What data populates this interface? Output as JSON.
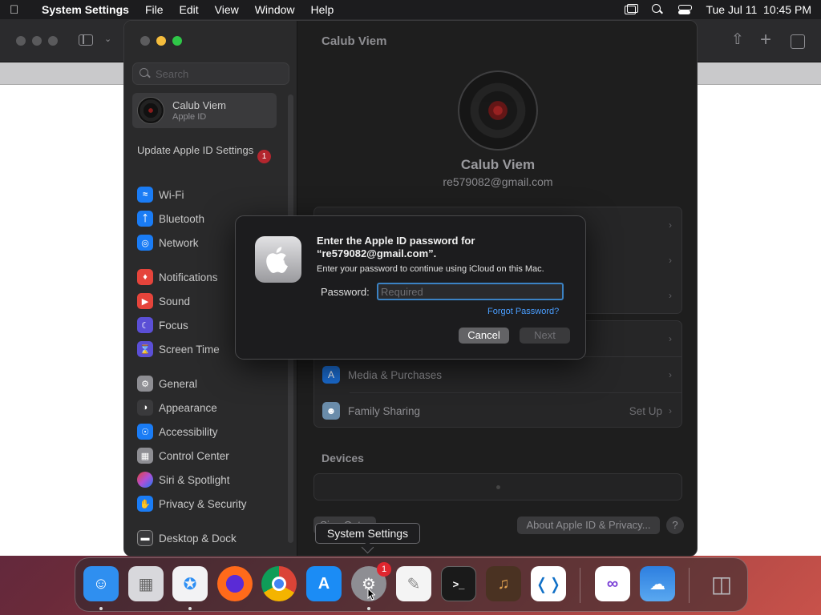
{
  "menubar": {
    "app": "System Settings",
    "items": [
      "File",
      "Edit",
      "View",
      "Window",
      "Help"
    ],
    "datetime": "Tue Jul 11  10:45 PM"
  },
  "sidebar": {
    "search_placeholder": "Search",
    "account": {
      "name": "Calub Viem",
      "sub": "Apple ID"
    },
    "update": {
      "label": "Update Apple ID Settings",
      "badge": "1"
    },
    "items": [
      {
        "label": "Wi-Fi",
        "icon": "wifi-icon",
        "color": "#1a7cf5"
      },
      {
        "label": "Bluetooth",
        "icon": "bluetooth-icon",
        "color": "#1a7cf5"
      },
      {
        "label": "Network",
        "icon": "globe-icon",
        "color": "#1a7cf5"
      },
      {
        "label": "Notifications",
        "icon": "bell-icon",
        "color": "#e5443b"
      },
      {
        "label": "Sound",
        "icon": "speaker-icon",
        "color": "#e5443b"
      },
      {
        "label": "Focus",
        "icon": "moon-icon",
        "color": "#5b4fd6"
      },
      {
        "label": "Screen Time",
        "icon": "hourglass-icon",
        "color": "#5b4fd6"
      },
      {
        "label": "General",
        "icon": "gear-icon",
        "color": "#8e8e93"
      },
      {
        "label": "Appearance",
        "icon": "appearance-icon",
        "color": "#3a3a3c"
      },
      {
        "label": "Accessibility",
        "icon": "accessibility-icon",
        "color": "#1a7cf5"
      },
      {
        "label": "Control Center",
        "icon": "control-center-icon",
        "color": "#8e8e93"
      },
      {
        "label": "Siri & Spotlight",
        "icon": "siri-icon",
        "color": "#b04fd6"
      },
      {
        "label": "Privacy & Security",
        "icon": "hand-icon",
        "color": "#1a7cf5"
      },
      {
        "label": "Desktop & Dock",
        "icon": "dock-icon",
        "color": "#3a3a3c"
      }
    ]
  },
  "content": {
    "title": "Calub Viem",
    "name": "Calub Viem",
    "email": "re579082@gmail.com",
    "rows": [
      {
        "label": "Media & Purchases",
        "value": ""
      },
      {
        "label": "Family Sharing",
        "value": "Set Up"
      }
    ],
    "devices_title": "Devices",
    "sign_out": "Sign Out...",
    "about": "About Apple ID & Privacy...",
    "help": "?"
  },
  "dialog": {
    "title": "Enter the Apple ID password for “re579082@gmail.com”.",
    "message": "Enter your password to continue using iCloud on this Mac.",
    "password_label": "Password:",
    "password_placeholder": "Required",
    "forgot": "Forgot Password?",
    "cancel": "Cancel",
    "next": "Next"
  },
  "tooltip": "System Settings",
  "dock": {
    "apps": [
      {
        "name": "Finder",
        "icon": "finder-icon",
        "color": "#2f8ff0"
      },
      {
        "name": "Launchpad",
        "icon": "launchpad-icon",
        "color": "#d8d8dc"
      },
      {
        "name": "Safari",
        "icon": "safari-icon",
        "color": "#2e8ff4"
      },
      {
        "name": "Firefox",
        "icon": "firefox-icon",
        "color": "#ff6a1a"
      },
      {
        "name": "Chrome",
        "icon": "chrome-icon",
        "color": "#ffffff"
      },
      {
        "name": "App Store",
        "icon": "app-store-icon",
        "color": "#1b8cf5"
      },
      {
        "name": "System Settings",
        "icon": "system-settings-icon",
        "color": "#8e8e93",
        "badge": "1"
      },
      {
        "name": "TextEdit",
        "icon": "textedit-icon",
        "color": "#f4f4f4"
      },
      {
        "name": "Terminal",
        "icon": "terminal-icon",
        "color": "#1a1a1a"
      },
      {
        "name": "GarageBand",
        "icon": "garageband-icon",
        "color": "#4a3222"
      },
      {
        "name": "Visual Studio Code",
        "icon": "vscode-icon",
        "color": "#ffffff"
      },
      {
        "name": "Visual Studio",
        "icon": "visual-studio-icon",
        "color": "#ffffff"
      },
      {
        "name": "Weather",
        "icon": "weather-icon",
        "color": "#2d7fe0"
      },
      {
        "name": "Trash",
        "icon": "trash-icon",
        "color": "#9a9a9e"
      }
    ]
  }
}
